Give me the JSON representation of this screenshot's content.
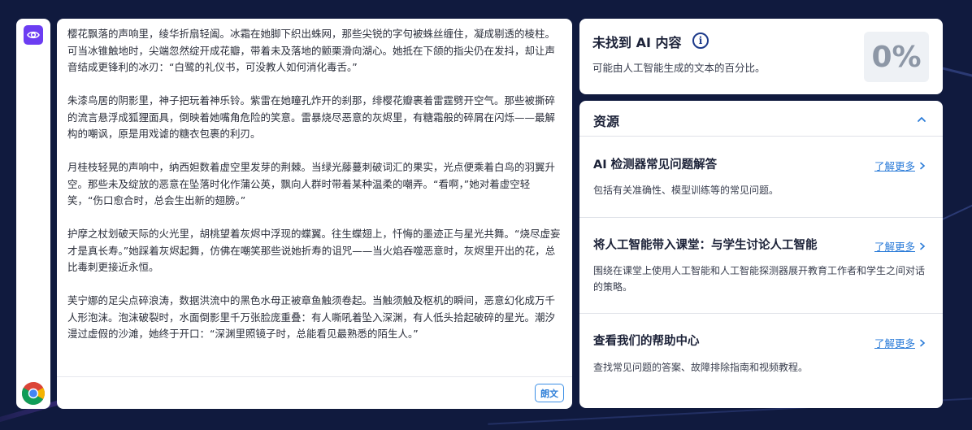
{
  "toolbar": {
    "eye_icon": "eye-icon",
    "browser_icon": "chrome-icon",
    "accent": "#6c3df2"
  },
  "text_panel": {
    "paragraphs": [
      "樱花飘落的声响里，绫华折扇轻阖。冰霜在她脚下织出蛛网，那些尖锐的字句被蛛丝缠住，凝成剔透的棱柱。可当冰锥触地时，尖端忽然绽开成花瓣，带着未及落地的颤栗滑向湖心。她抵在下颌的指尖仍在发抖，却让声音结成更锋利的冰刃：“白鹭的礼仪书，可没教人如何消化毒舌。”",
      "朱漆鸟居的阴影里，神子把玩着神乐铃。紫雷在她瞳孔炸开的刹那，绯樱花瓣裹着雷霆劈开空气。那些被撕碎的流言悬浮成狐狸面具，倒映着她嘴角危险的笑意。雷暴烧尽恶意的灰烬里，有糖霜般的碎屑在闪烁——最解构的嘲讽，原是用戏谑的糖衣包裹的利刃。",
      "月桂枝轻晃的声响中，纳西妲数着虚空里发芽的荆棘。当绿光藤蔓刺破词汇的果实，光点便乘着白鸟的羽翼升空。那些未及绽放的恶意在坠落时化作蒲公英，飘向人群时带着某种温柔的嘲弄。“看啊，”她对着虚空轻笑，“伤口愈合时，总会生出新的翅膀。”",
      "护摩之杖划破天际的火光里，胡桃望着灰烬中浮现的蝶翼。往生蝶翅上，忏悔的墨迹正与星光共舞。“烧尽虚妄才是真长寿。”她踩着灰烬起舞，仿佛在嘲笑那些说她折寿的诅咒——当火焰吞噬恶意时，灰烬里开出的花，总比毒刺更接近永恒。",
      "芙宁娜的足尖点碎浪涛，数据洪流中的黑色水母正被章鱼触须卷起。当触须触及枢机的瞬间，恶意幻化成万千人形泡沫。泡沫破裂时，水面倒影里千万张脸庞重叠：有人嘶吼着坠入深渊，有人低头拾起破碎的星光。潮汐漫过虚假的沙滩，她终于开口：“深渊里照镜子时，总能看见最熟悉的陌生人。”"
    ],
    "lang_button": "朗文"
  },
  "result": {
    "title": "未找到 AI 内容",
    "description": "可能由人工智能生成的文本的百分比。",
    "percent": "0%"
  },
  "resources": {
    "title": "资源",
    "items": [
      {
        "title": "AI 检测器常见问题解答",
        "link": "了解更多",
        "description": "包括有关准确性、模型训练等的常见问题。"
      },
      {
        "title": "将人工智能带入课堂：与学生讨论人工智能",
        "link": "了解更多",
        "description": "围绕在课堂上使用人工智能和人工智能探测器展开教育工作者和学生之间对话的策略。"
      },
      {
        "title": "查看我们的帮助中心",
        "link": "了解更多",
        "description": "查找常见问题的答案、故障排除指南和视频教程。"
      }
    ]
  }
}
